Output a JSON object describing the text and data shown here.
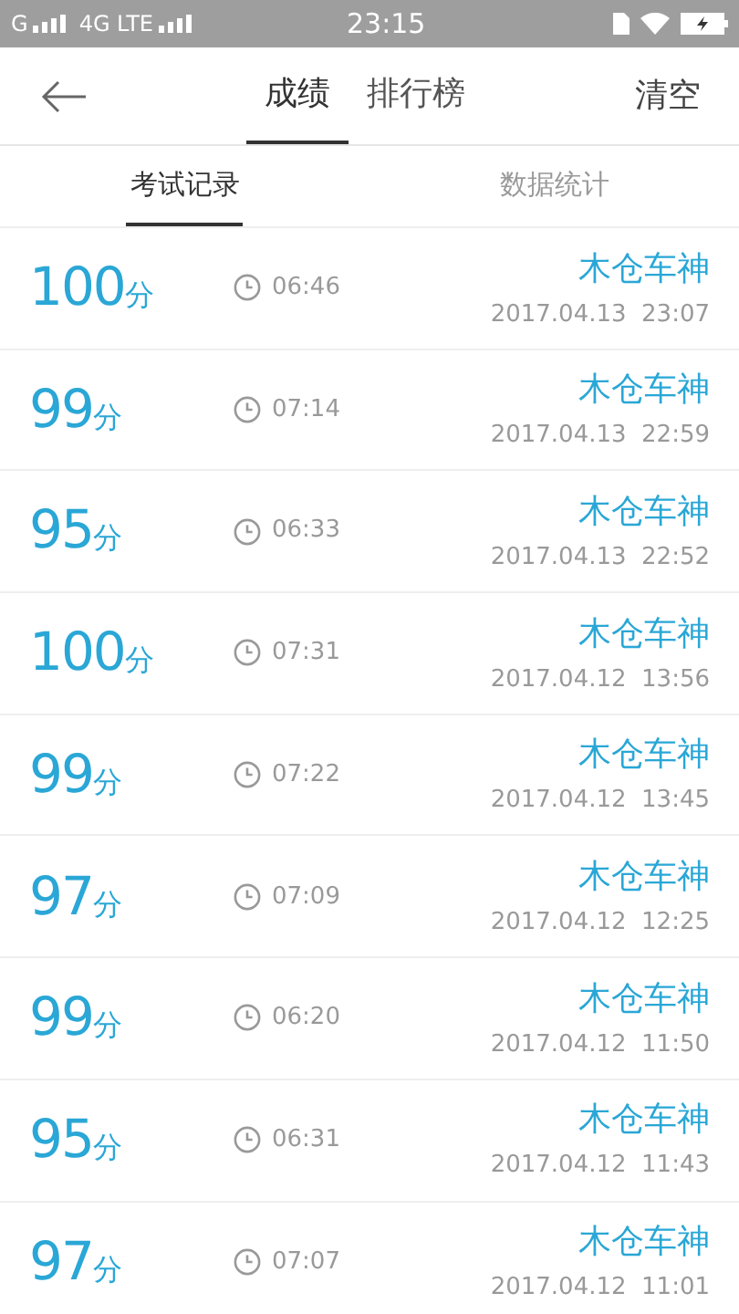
{
  "status_bar": {
    "carrier_1": "G",
    "carrier_2": "4G LTE",
    "time": "23:15"
  },
  "header": {
    "tabs": [
      {
        "label": "成绩",
        "selected": true
      },
      {
        "label": "排行榜",
        "selected": false
      }
    ],
    "action": "清空"
  },
  "sub_tabs": [
    {
      "label": "考试记录",
      "selected": true
    },
    {
      "label": "数据统计",
      "selected": false
    }
  ],
  "records": [
    {
      "score": "100",
      "unit": "分",
      "duration": "06:46",
      "name": "木仓车神",
      "date": "2017.04.13  23:07"
    },
    {
      "score": "99",
      "unit": "分",
      "duration": "07:14",
      "name": "木仓车神",
      "date": "2017.04.13  22:59"
    },
    {
      "score": "95",
      "unit": "分",
      "duration": "06:33",
      "name": "木仓车神",
      "date": "2017.04.13  22:52"
    },
    {
      "score": "100",
      "unit": "分",
      "duration": "07:31",
      "name": "木仓车神",
      "date": "2017.04.12  13:56"
    },
    {
      "score": "99",
      "unit": "分",
      "duration": "07:22",
      "name": "木仓车神",
      "date": "2017.04.12  13:45"
    },
    {
      "score": "97",
      "unit": "分",
      "duration": "07:09",
      "name": "木仓车神",
      "date": "2017.04.12  12:25"
    },
    {
      "score": "99",
      "unit": "分",
      "duration": "06:20",
      "name": "木仓车神",
      "date": "2017.04.12  11:50"
    },
    {
      "score": "95",
      "unit": "分",
      "duration": "06:31",
      "name": "木仓车神",
      "date": "2017.04.12  11:43"
    },
    {
      "score": "97",
      "unit": "分",
      "duration": "07:07",
      "name": "木仓车神",
      "date": "2017.04.12  11:01"
    }
  ]
}
